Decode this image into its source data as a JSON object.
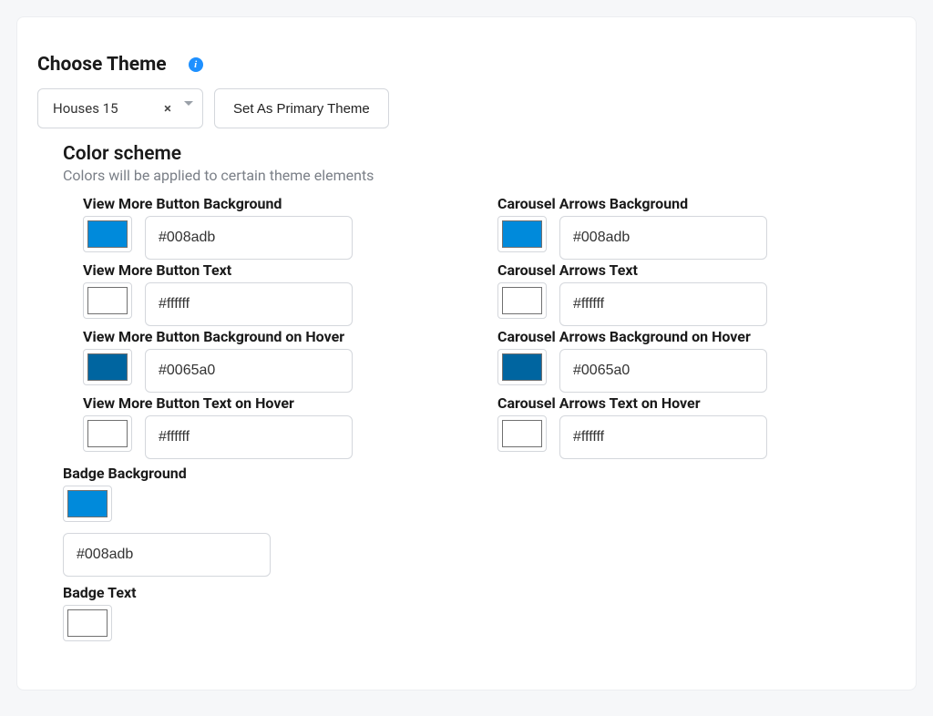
{
  "heading": "Choose Theme",
  "info_icon_glyph": "i",
  "theme_select": {
    "selected": "Houses 15",
    "clear_glyph": "×"
  },
  "primary_button": "Set As Primary Theme",
  "color_scheme": {
    "title": "Color scheme",
    "subtitle": "Colors will be applied to certain theme elements"
  },
  "left_fields": [
    {
      "label": "View More Button Background",
      "hex": "#008adb",
      "swatch": "#008adb"
    },
    {
      "label": "View More Button Text",
      "hex": "#ffffff",
      "swatch": "#ffffff"
    },
    {
      "label": "View More Button Background on Hover",
      "hex": "#0065a0",
      "swatch": "#0065a0"
    },
    {
      "label": "View More Button Text on Hover",
      "hex": "#ffffff",
      "swatch": "#ffffff"
    }
  ],
  "right_fields": [
    {
      "label": "Carousel Arrows Background",
      "hex": "#008adb",
      "swatch": "#008adb"
    },
    {
      "label": "Carousel Arrows Text",
      "hex": "#ffffff",
      "swatch": "#ffffff"
    },
    {
      "label": "Carousel Arrows Background on Hover",
      "hex": "#0065a0",
      "swatch": "#0065a0"
    },
    {
      "label": "Carousel Arrows Text on Hover",
      "hex": "#ffffff",
      "swatch": "#ffffff"
    }
  ],
  "badge_bg": {
    "label": "Badge Background",
    "hex": "#008adb",
    "swatch": "#008adb"
  },
  "badge_text": {
    "label": "Badge Text",
    "swatch": "#ffffff"
  }
}
